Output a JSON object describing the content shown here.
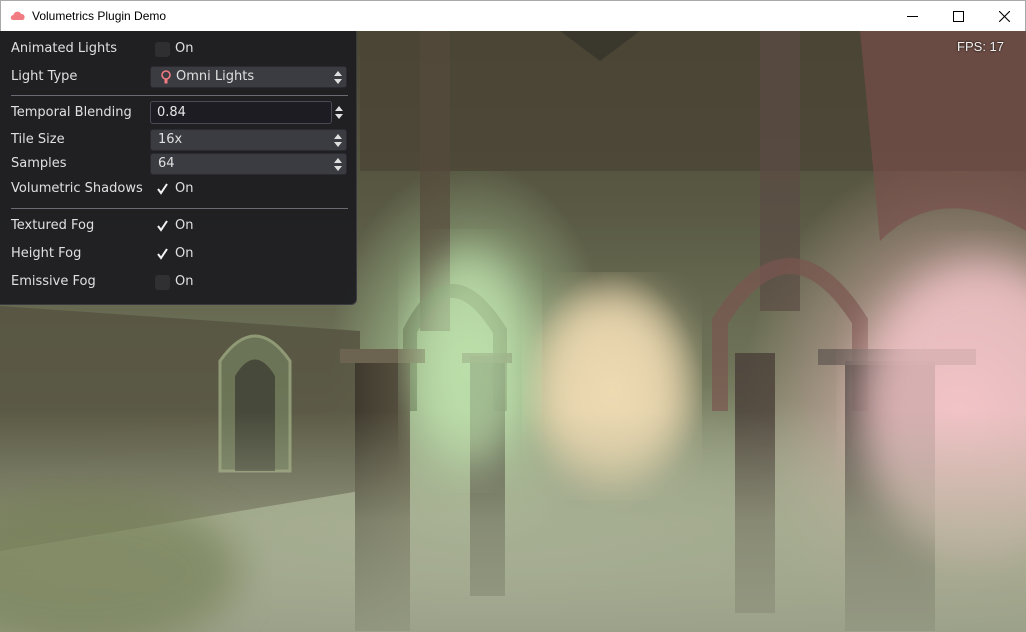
{
  "window": {
    "title": "Volumetrics Plugin Demo"
  },
  "overlay": {
    "fps": "FPS: 17"
  },
  "settings": {
    "animated_lights": {
      "label": "Animated Lights",
      "checked": false,
      "state": "On"
    },
    "light_type": {
      "label": "Light Type",
      "value": "Omni Lights",
      "icon": "bulb-icon"
    },
    "temporal_blending": {
      "label": "Temporal Blending",
      "value": "0.84"
    },
    "tile_size": {
      "label": "Tile Size",
      "value": "16x"
    },
    "samples": {
      "label": "Samples",
      "value": "64"
    },
    "volumetric_shadows": {
      "label": "Volumetric Shadows",
      "checked": true,
      "state": "On"
    },
    "textured_fog": {
      "label": "Textured Fog",
      "checked": true,
      "state": "On"
    },
    "height_fog": {
      "label": "Height Fog",
      "checked": true,
      "state": "On"
    },
    "emissive_fog": {
      "label": "Emissive Fog",
      "checked": false,
      "state": "On"
    }
  },
  "colors": {
    "panel_bg": "#1e1e22",
    "accent_icon": "#f07b80"
  }
}
